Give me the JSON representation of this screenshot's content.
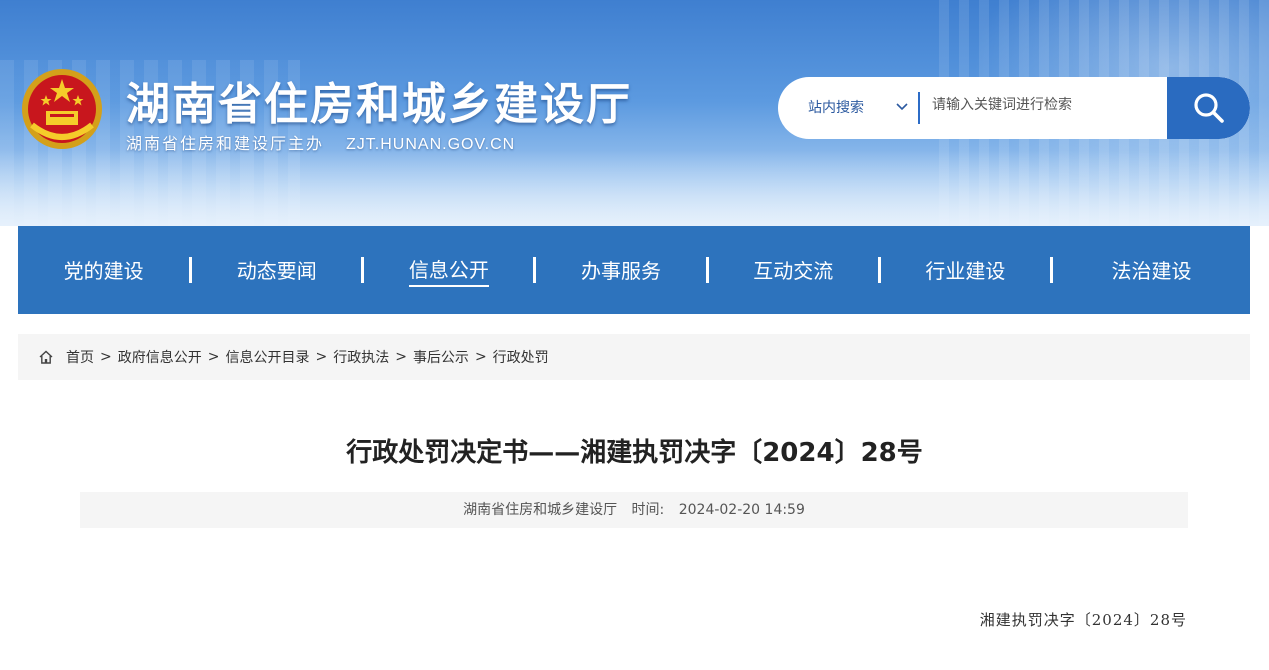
{
  "header": {
    "site_title": "湖南省住房和城乡建设厅",
    "site_subtitle": "湖南省住房和建设厅主办",
    "domain": "ZJT.HUNAN.GOV.CN",
    "emblem_icon": "national-emblem-icon"
  },
  "search": {
    "scope_label": "站内搜索",
    "placeholder": "请输入关键词进行检索",
    "button_icon": "search-icon"
  },
  "nav": {
    "items": [
      {
        "label": "党的建设"
      },
      {
        "label": "动态要闻"
      },
      {
        "label": "信息公开"
      },
      {
        "label": "办事服务"
      },
      {
        "label": "互动交流"
      },
      {
        "label": "行业建设"
      },
      {
        "label": "法治建设"
      }
    ],
    "active_label": "信息公开"
  },
  "breadcrumb": {
    "home_icon": "home-icon",
    "items": [
      "首页",
      "政府信息公开",
      "信息公开目录",
      "行政执法",
      "事后公示",
      "行政处罚"
    ],
    "separator": ">"
  },
  "article": {
    "title": "行政处罚决定书——湘建执罚决字〔2024〕28号",
    "source": "湖南省住房和城乡建设厅",
    "time_label": "时间:",
    "time_value": "2024-02-20 14:59",
    "doc_number": "湘建执罚决字〔2024〕28号"
  },
  "colors": {
    "nav_bg": "#2d73bd",
    "search_button": "#2a6bc0",
    "banner_top": "#3f7fd0"
  }
}
